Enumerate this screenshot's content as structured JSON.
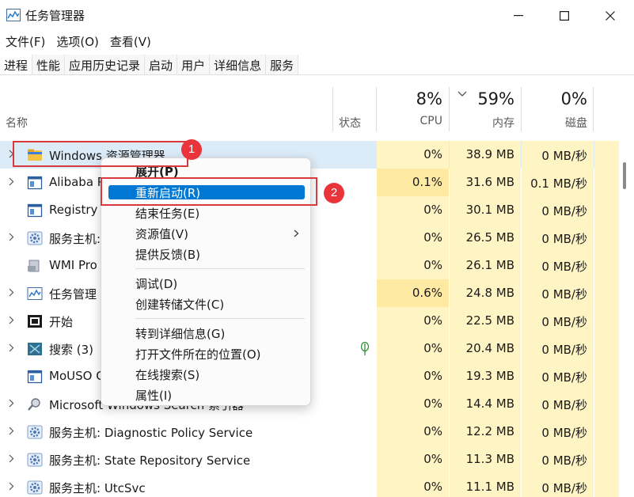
{
  "window": {
    "title": "任务管理器",
    "controls": [
      "minimize",
      "maximize",
      "close"
    ]
  },
  "menubar": [
    "文件(F)",
    "选项(O)",
    "查看(V)"
  ],
  "tabs": [
    "进程",
    "性能",
    "应用历史记录",
    "启动",
    "用户",
    "详细信息",
    "服务"
  ],
  "header": {
    "name": "名称",
    "status": "状态",
    "cpu_pct": "8%",
    "cpu": "CPU",
    "mem_pct": "59%",
    "mem": "内存",
    "disk_pct": "0%",
    "disk": "磁盘"
  },
  "rows": [
    {
      "name": "Windows 资源管理器",
      "cpu": "0%",
      "mem": "38.9 MB",
      "disk": "0 MB/秒",
      "icon": "folder-icon",
      "expandable": true,
      "selected": true
    },
    {
      "name": "Alibaba P",
      "cpu": "0.1%",
      "mem": "31.6 MB",
      "disk": "0.1 MB/秒",
      "icon": "app-window-icon",
      "expandable": true
    },
    {
      "name": "Registry",
      "cpu": "0%",
      "mem": "30.1 MB",
      "disk": "0 MB/秒",
      "icon": "app-window-icon",
      "expandable": false
    },
    {
      "name": "服务主机:",
      "cpu": "0%",
      "mem": "26.5 MB",
      "disk": "0 MB/秒",
      "icon": "gear-icon",
      "expandable": true
    },
    {
      "name": "WMI Pro",
      "cpu": "0%",
      "mem": "26.1 MB",
      "disk": "0 MB/秒",
      "icon": "wmi-icon",
      "expandable": false
    },
    {
      "name": "任务管理",
      "cpu": "0.6%",
      "mem": "24.8 MB",
      "disk": "0 MB/秒",
      "icon": "task-manager-icon",
      "expandable": true
    },
    {
      "name": "开始",
      "cpu": "0%",
      "mem": "22.5 MB",
      "disk": "0 MB/秒",
      "icon": "start-icon",
      "expandable": true
    },
    {
      "name": "搜索 (3)",
      "cpu": "0%",
      "mem": "20.4 MB",
      "disk": "0 MB/秒",
      "icon": "search-app-icon",
      "expandable": true,
      "status_leaf": true
    },
    {
      "name": "MoUSO C",
      "cpu": "0%",
      "mem": "19.3 MB",
      "disk": "0 MB/秒",
      "icon": "app-window-icon",
      "expandable": false
    },
    {
      "name": "Microsoft Windows Search 索引器",
      "cpu": "0%",
      "mem": "14.4 MB",
      "disk": "0 MB/秒",
      "icon": "search-indexer-icon",
      "expandable": true
    },
    {
      "name": "服务主机: Diagnostic Policy Service",
      "cpu": "0%",
      "mem": "12.2 MB",
      "disk": "0 MB/秒",
      "icon": "gear-icon",
      "expandable": true
    },
    {
      "name": "服务主机: State Repository Service",
      "cpu": "0%",
      "mem": "11.3 MB",
      "disk": "0 MB/秒",
      "icon": "gear-icon",
      "expandable": true
    },
    {
      "name": "服务主机: UtcSvc",
      "cpu": "0%",
      "mem": "11.1 MB",
      "disk": "0 MB/秒",
      "icon": "gear-icon",
      "expandable": true
    }
  ],
  "context_menu": {
    "items": [
      {
        "label": "展开(P)",
        "bold": true
      },
      {
        "label": "重新启动(R)",
        "highlighted": true
      },
      {
        "label": "结束任务(E)"
      },
      {
        "label": "资源值(V)",
        "submenu": true
      },
      {
        "label": "提供反馈(B)"
      },
      {
        "label": "调试(D)"
      },
      {
        "label": "创建转储文件(C)"
      },
      {
        "label": "转到详细信息(G)"
      },
      {
        "label": "打开文件所在的位置(O)"
      },
      {
        "label": "在线搜索(S)"
      },
      {
        "label": "属性(I)"
      }
    ]
  },
  "annotations": {
    "badge1": "1",
    "badge2": "2",
    "color": "#e8343a"
  },
  "colors": {
    "accent": "#0078d4",
    "heat_light": "#fff4c4",
    "heat_dark": "#ffeaa3",
    "selection": "#dcebf8"
  }
}
